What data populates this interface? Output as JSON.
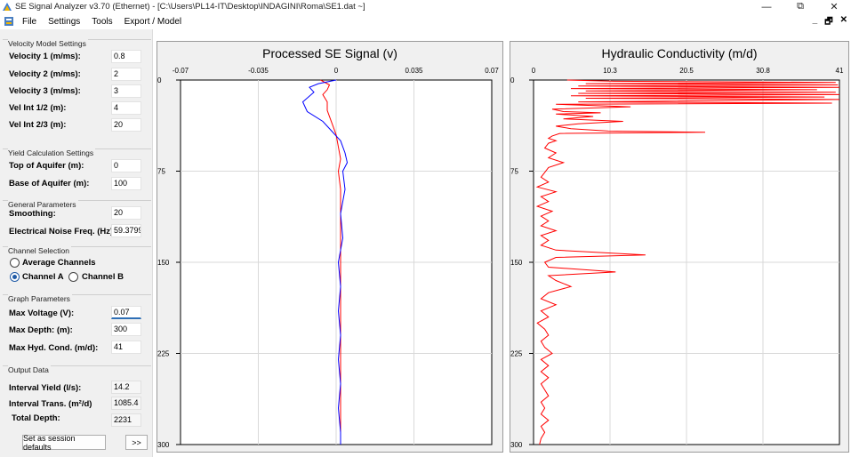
{
  "window": {
    "title": "SE Signal Analyzer v3.70 (Ethernet) - [C:\\Users\\PL14-IT\\Desktop\\INDAGINI\\Roma\\SE1.dat ~]",
    "minimize": "—",
    "restore": "⧉",
    "close": "✕"
  },
  "menu": {
    "items": [
      "File",
      "Settings",
      "Tools",
      "Export / Model"
    ],
    "mdi_minimize": "_",
    "mdi_restore": "🗗",
    "mdi_close": "✕"
  },
  "velocity_model": {
    "title": "Velocity Model Settings",
    "rows": [
      {
        "label": "Velocity 1 (m/ms):",
        "value": "0.8"
      },
      {
        "label": "Velocity 2 (m/ms):",
        "value": "2"
      },
      {
        "label": "Velocity 3 (m/ms):",
        "value": "3"
      },
      {
        "label": "Vel Int 1/2 (m):",
        "value": "4"
      },
      {
        "label": "Vel Int 2/3 (m):",
        "value": "20"
      }
    ]
  },
  "yield_calc": {
    "title": "Yield Calculation Settings",
    "rows": [
      {
        "label": "Top of Aquifer (m):",
        "value": "0"
      },
      {
        "label": "Base of Aquifer (m):",
        "value": "100"
      }
    ]
  },
  "general": {
    "title": "General Parameters",
    "smoothing_label": "Smoothing:",
    "smoothing_value": "20",
    "noise_label": "Electrical Noise Freq. (Hz):",
    "noise_value": "59.37999"
  },
  "channel": {
    "title": "Channel Selection",
    "average_label": "Average Channels",
    "channel_a_label": "Channel A",
    "channel_b_label": "Channel B",
    "selected": "Channel A"
  },
  "graph_params": {
    "title": "Graph Parameters",
    "rows": [
      {
        "label": "Max Voltage (V):",
        "value": "0.07"
      },
      {
        "label": "Max Depth: (m):",
        "value": "300"
      },
      {
        "label": "Max Hyd. Cond.  (m/d):",
        "value": "41"
      }
    ]
  },
  "output": {
    "title": "Output Data",
    "rows": [
      {
        "label": "Interval Yield (l/s):",
        "value": "14.2"
      },
      {
        "label": "Interval Trans. (m²/d)",
        "value": "1085.4"
      },
      {
        "label": "Total Depth:",
        "value": "2231"
      }
    ]
  },
  "buttons": {
    "session_defaults": "Set as session defaults",
    "expand": ">>"
  },
  "colors": {
    "channel_a": "#ff0000",
    "channel_b": "#0000ff",
    "hyd_cond": "#ff0000",
    "focus": "#2f6fb6"
  },
  "chart_data": [
    {
      "type": "line",
      "title": "Processed SE Signal (v)",
      "x_ticks": [
        "-0.07",
        "-0.035",
        "0",
        "0.035",
        "0.07"
      ],
      "y_ticks": [
        "0",
        "75",
        "150",
        "225",
        "300"
      ],
      "xlim": [
        -0.07,
        0.07
      ],
      "ylim": [
        0,
        300
      ],
      "y_inverted": true,
      "grid": true,
      "series": [
        {
          "color": "#ff0000",
          "points": [
            [
              -0.007,
              0
            ],
            [
              -0.003,
              4
            ],
            [
              -0.004,
              8
            ],
            [
              -0.006,
              12
            ],
            [
              -0.004,
              18
            ],
            [
              -0.004,
              25
            ],
            [
              -0.002,
              35
            ],
            [
              0.0,
              45
            ],
            [
              0.001,
              55
            ],
            [
              0.002,
              65
            ],
            [
              0.001,
              75
            ],
            [
              0.002,
              90
            ],
            [
              0.002,
              110
            ],
            [
              0.002,
              130
            ],
            [
              0.002,
              150
            ],
            [
              0.002,
              170
            ],
            [
              0.002,
              190
            ],
            [
              0.002,
              210
            ],
            [
              0.002,
              230
            ],
            [
              0.002,
              250
            ],
            [
              0.002,
              270
            ],
            [
              0.002,
              290
            ],
            [
              0.002,
              300
            ]
          ]
        },
        {
          "color": "#0000ff",
          "points": [
            [
              0.0,
              0
            ],
            [
              -0.008,
              3
            ],
            [
              -0.012,
              6
            ],
            [
              -0.01,
              10
            ],
            [
              -0.015,
              18
            ],
            [
              -0.013,
              26
            ],
            [
              -0.006,
              34
            ],
            [
              -0.002,
              42
            ],
            [
              0.002,
              50
            ],
            [
              0.004,
              60
            ],
            [
              0.005,
              68
            ],
            [
              0.003,
              75
            ],
            [
              0.004,
              90
            ],
            [
              0.002,
              110
            ],
            [
              0.003,
              130
            ],
            [
              0.001,
              150
            ],
            [
              0.002,
              170
            ],
            [
              0.001,
              190
            ],
            [
              0.002,
              210
            ],
            [
              0.001,
              230
            ],
            [
              0.002,
              250
            ],
            [
              0.001,
              270
            ],
            [
              0.002,
              290
            ],
            [
              0.002,
              300
            ]
          ]
        }
      ]
    },
    {
      "type": "line",
      "title": "Hydraulic Conductivity (m/d)",
      "x_ticks": [
        "0",
        "10.3",
        "20.5",
        "30.8",
        "41"
      ],
      "y_ticks": [
        "0",
        "75",
        "150",
        "225",
        "300"
      ],
      "xlim": [
        0,
        41
      ],
      "ylim": [
        0,
        300
      ],
      "y_inverted": true,
      "grid": true,
      "series": [
        {
          "color": "#ff0000",
          "points": [
            [
              4.5,
              0
            ],
            [
              10.8,
              1
            ],
            [
              40.5,
              2
            ],
            [
              7,
              3
            ],
            [
              40.8,
              4
            ],
            [
              6,
              5
            ],
            [
              41,
              6
            ],
            [
              5,
              7
            ],
            [
              38,
              8
            ],
            [
              7,
              9
            ],
            [
              40.5,
              10
            ],
            [
              6,
              11
            ],
            [
              41,
              12
            ],
            [
              5,
              13
            ],
            [
              39,
              14
            ],
            [
              7,
              15
            ],
            [
              41,
              16
            ],
            [
              6,
              18
            ],
            [
              40,
              19
            ],
            [
              3,
              20
            ],
            [
              13,
              22
            ],
            [
              2.5,
              24
            ],
            [
              4,
              26
            ],
            [
              9,
              27
            ],
            [
              3,
              28
            ],
            [
              8,
              30
            ],
            [
              4,
              32
            ],
            [
              12,
              34
            ],
            [
              6,
              36
            ],
            [
              3,
              38
            ],
            [
              5,
              40
            ],
            [
              10,
              42
            ],
            [
              23,
              43
            ],
            [
              3.5,
              44
            ],
            [
              2.5,
              46
            ],
            [
              2,
              48
            ],
            [
              3,
              50
            ],
            [
              2,
              52
            ],
            [
              1.5,
              56
            ],
            [
              3,
              60
            ],
            [
              2,
              64
            ],
            [
              4,
              68
            ],
            [
              2,
              72
            ],
            [
              1.5,
              76
            ],
            [
              1,
              80
            ],
            [
              2,
              84
            ],
            [
              0.5,
              88
            ],
            [
              3,
              92
            ],
            [
              1,
              96
            ],
            [
              2,
              100
            ],
            [
              0.5,
              104
            ],
            [
              2.5,
              108
            ],
            [
              1,
              112
            ],
            [
              2,
              116
            ],
            [
              1,
              120
            ],
            [
              3,
              124
            ],
            [
              1,
              128
            ],
            [
              2,
              132
            ],
            [
              1,
              136
            ],
            [
              3,
              140
            ],
            [
              15,
              144
            ],
            [
              3,
              146
            ],
            [
              1.5,
              150
            ],
            [
              2,
              154
            ],
            [
              9,
              157
            ],
            [
              11,
              158
            ],
            [
              2,
              161
            ],
            [
              3,
              165
            ],
            [
              5,
              170
            ],
            [
              2,
              175
            ],
            [
              1,
              180
            ],
            [
              3,
              185
            ],
            [
              1,
              190
            ],
            [
              2,
              195
            ],
            [
              0.5,
              200
            ],
            [
              1.5,
              205
            ],
            [
              2,
              210
            ],
            [
              1,
              215
            ],
            [
              1.5,
              220
            ],
            [
              2.5,
              225
            ],
            [
              1,
              230
            ],
            [
              2,
              235
            ],
            [
              1,
              240
            ],
            [
              2,
              245
            ],
            [
              1,
              250
            ],
            [
              1.5,
              255
            ],
            [
              2,
              260
            ],
            [
              1,
              265
            ],
            [
              1.5,
              270
            ],
            [
              1,
              275
            ],
            [
              2,
              280
            ],
            [
              1,
              285
            ],
            [
              1.5,
              290
            ],
            [
              1,
              295
            ],
            [
              0.8,
              300
            ]
          ]
        }
      ]
    }
  ]
}
